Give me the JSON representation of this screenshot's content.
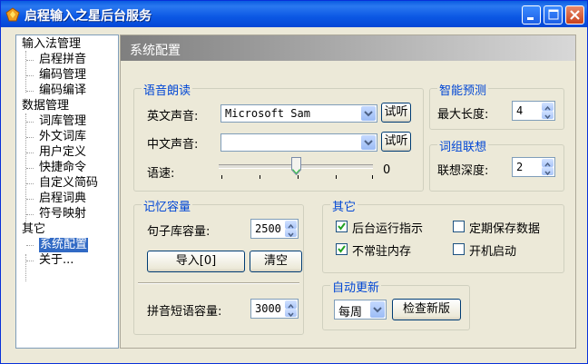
{
  "window": {
    "title": "启程输入之星后台服务"
  },
  "tree": {
    "groups": [
      {
        "label": "输入法管理",
        "children": [
          "启程拼音",
          "编码管理",
          "编码编译"
        ]
      },
      {
        "label": "数据管理",
        "children": [
          "词库管理",
          "外文词库",
          "用户定义",
          "快捷命令",
          "自定义简码",
          "启程词典",
          "符号映射"
        ]
      },
      {
        "label": "其它",
        "children": [
          "系统配置",
          "关于..."
        ]
      }
    ]
  },
  "header": {
    "title": "系统配置"
  },
  "voice": {
    "title": "语音朗读",
    "english_label": "英文声音:",
    "english_value": "Microsoft Sam",
    "chinese_label": "中文声音:",
    "chinese_value": "",
    "listen_label": "试听",
    "speed_label": "语速:",
    "speed_value": "0"
  },
  "predict": {
    "title": "智能预测",
    "max_len_label": "最大长度:",
    "max_len_value": "4"
  },
  "phrase": {
    "title": "词组联想",
    "depth_label": "联想深度:",
    "depth_value": "2"
  },
  "memory": {
    "title": "记忆容量",
    "sentence_label": "句子库容量:",
    "sentence_value": "2500",
    "import_label": "导入[0]",
    "clear_label": "清空",
    "pinyin_label": "拼音短语容量:",
    "pinyin_value": "3000"
  },
  "other": {
    "title": "其它",
    "opt1": "后台运行指示",
    "opt1_checked": true,
    "opt2": "定期保存数据",
    "opt2_checked": false,
    "opt3": "不常驻内存",
    "opt3_checked": true,
    "opt4": "开机启动",
    "opt4_checked": false
  },
  "update": {
    "title": "自动更新",
    "freq_value": "每周",
    "check_label": "检查新版"
  }
}
